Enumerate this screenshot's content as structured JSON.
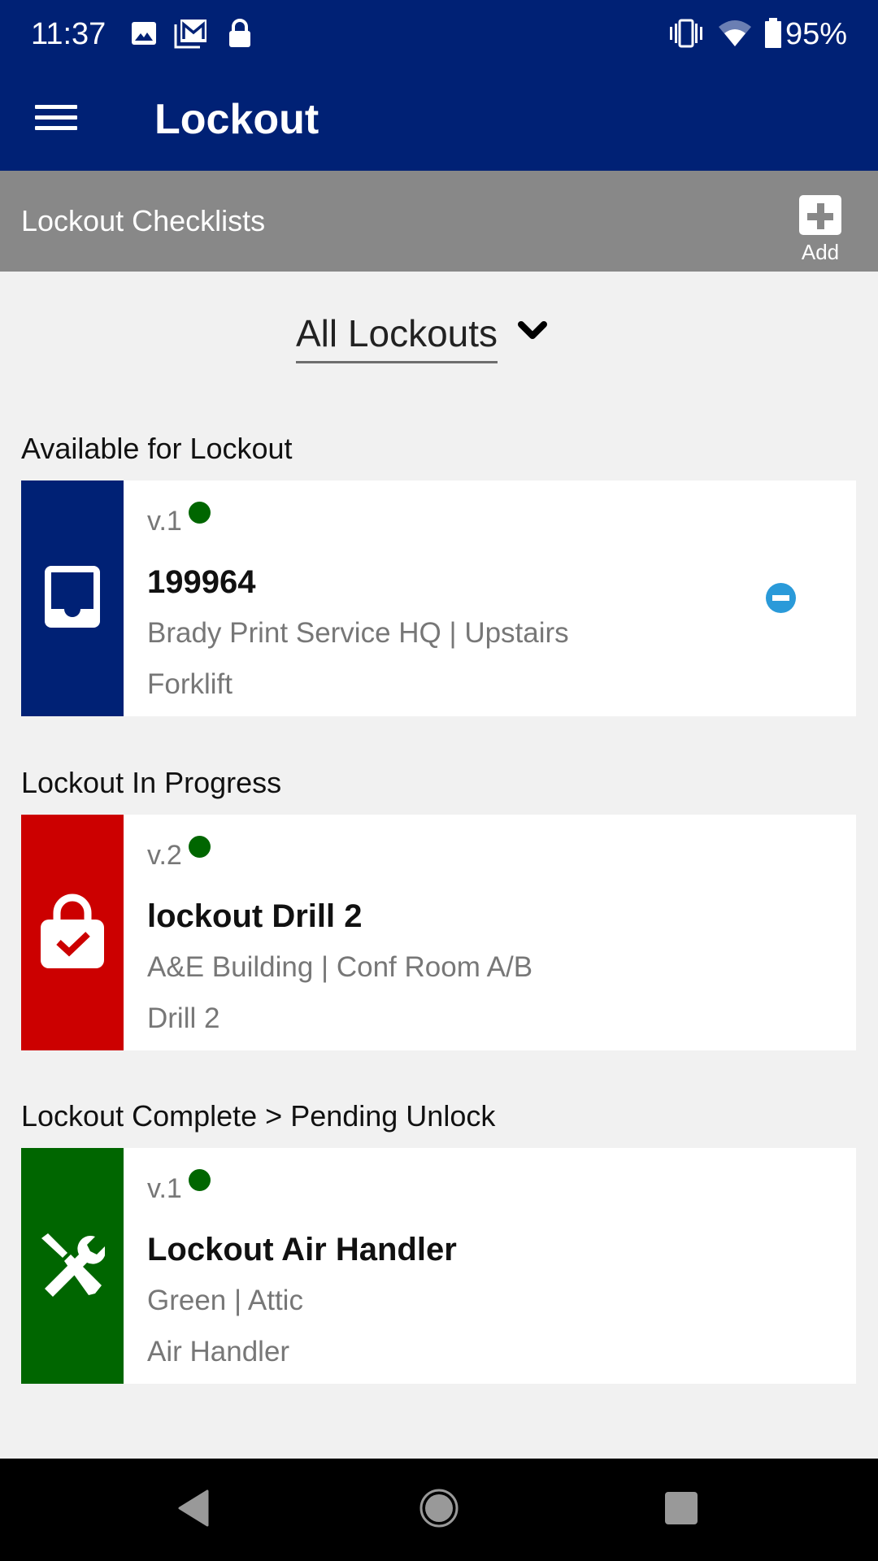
{
  "status_bar": {
    "time": "11:37",
    "left_icons": [
      "image-icon",
      "gmail-icon",
      "lock-icon"
    ],
    "right_icons": [
      "vibrate-icon",
      "wifi-icon",
      "battery-icon"
    ],
    "battery_percent": "95%"
  },
  "app_bar": {
    "title": "Lockout",
    "menu_icon": "hamburger-menu-icon"
  },
  "sub_header": {
    "title": "Lockout Checklists",
    "add_label": "Add",
    "add_icon": "plus-box-icon"
  },
  "filter": {
    "selected": "All Lockouts",
    "icon": "chevron-down-icon"
  },
  "colors": {
    "brand_blue": "#002175",
    "header_gray": "#888888",
    "available": "#002175",
    "in_progress": "#cc0000",
    "complete": "#006600",
    "status_dot": "#006600",
    "remove": "#2a9ad9"
  },
  "sections": [
    {
      "label": "Available for Lockout",
      "cards": [
        {
          "version": "v.1",
          "title": "199964",
          "location": "Brady Print Service HQ | Upstairs",
          "equipment": "Forklift",
          "icon": "inbox-tray-icon",
          "has_remove": true
        }
      ]
    },
    {
      "label": "Lockout In Progress",
      "cards": [
        {
          "version": "v.2",
          "title": "lockout Drill 2",
          "location": "A&E Building | Conf Room A/B",
          "equipment": "Drill 2",
          "icon": "lock-check-icon",
          "has_remove": false
        }
      ]
    },
    {
      "label": "Lockout Complete > Pending Unlock",
      "cards": [
        {
          "version": "v.1",
          "title": "Lockout Air Handler",
          "location": "Green | Attic",
          "equipment": "Air Handler",
          "icon": "tools-icon",
          "has_remove": false
        }
      ]
    }
  ],
  "nav_bar": {
    "buttons": [
      "back-icon",
      "home-icon",
      "recents-icon"
    ]
  }
}
